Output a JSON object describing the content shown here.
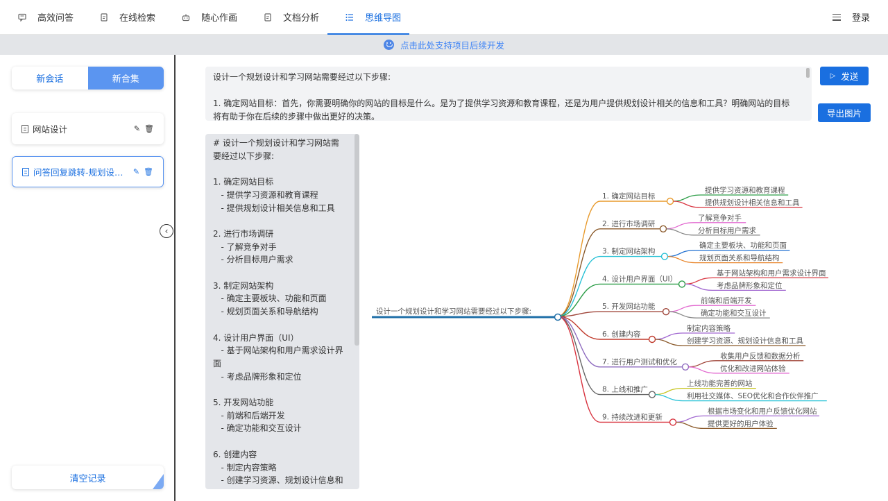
{
  "nav": {
    "items": [
      {
        "label": "高效问答",
        "icon": "chat-icon"
      },
      {
        "label": "在线检索",
        "icon": "document-icon"
      },
      {
        "label": "随心作画",
        "icon": "robot-icon"
      },
      {
        "label": "文档分析",
        "icon": "document-icon"
      },
      {
        "label": "思维导图",
        "icon": "list-icon",
        "active": true
      }
    ],
    "login": "登录"
  },
  "banner": {
    "text": "点击此处支持项目后续开发"
  },
  "sidebar": {
    "seg_new_chat": "新会话",
    "seg_new_collection": "新合集",
    "sessions": [
      {
        "title": "网站设计"
      },
      {
        "title": "问答回复跳转-规划设计..."
      }
    ],
    "clear": "清空记录"
  },
  "prompt": {
    "line1": "设计一个规划设计和学习网站需要经过以下步骤:",
    "line2": "1. 确定网站目标：首先，你需要明确你的网站的目标是什么。是为了提供学习资源和教育课程，还是为用户提供规划设计相关的信息和工具？明确网站的目标将有助于你在后续的步骤中做出更好的决策。"
  },
  "buttons": {
    "send": "发送",
    "export": "导出图片"
  },
  "markdown": [
    "# 设计一个规划设计和学习网站需要经过以下步骤:",
    "",
    "1. 确定网站目标",
    "   - 提供学习资源和教育课程",
    "   - 提供规划设计相关信息和工具",
    "",
    "2. 进行市场调研",
    "   - 了解竞争对手",
    "   - 分析目标用户需求",
    "",
    "3. 制定网站架构",
    "   - 确定主要板块、功能和页面",
    "   - 规划页面关系和导航结构",
    "",
    "4. 设计用户界面（UI）",
    "   - 基于网站架构和用户需求设计界面",
    "   - 考虑品牌形象和定位",
    "",
    "5. 开发网站功能",
    "   - 前端和后端开发",
    "   - 确定功能和交互设计",
    "",
    "6. 创建内容",
    "   - 制定内容策略",
    "   - 创建学习资源、规划设计信息和工具"
  ],
  "mindmap": {
    "root": "设计一个规划设计和学习网站需要经过以下步骤:",
    "root_color": "#1f6fa8",
    "branches": [
      {
        "label": "1. 确定网站目标",
        "color": "#e89a2c",
        "children": [
          {
            "label": "提供学习资源和教育课程",
            "color": "#2e9e49"
          },
          {
            "label": "提供规划设计相关信息和工具",
            "color": "#d8333f"
          }
        ]
      },
      {
        "label": "2. 进行市场调研",
        "color": "#8b5a2b",
        "children": [
          {
            "label": "了解竞争对手",
            "color": "#e26ad0"
          },
          {
            "label": "分析目标用户需求",
            "color": "#888888"
          }
        ]
      },
      {
        "label": "3. 制定网站架构",
        "color": "#27c1d6",
        "children": [
          {
            "label": "确定主要板块、功能和页面",
            "color": "#1f6fd0"
          },
          {
            "label": "规划页面关系和导航结构",
            "color": "#e8862c"
          }
        ]
      },
      {
        "label": "4. 设计用户界面（UI）",
        "color": "#2e9e49",
        "children": [
          {
            "label": "基于网站架构和用户需求设计界面",
            "color": "#d8333f"
          },
          {
            "label": "考虑品牌形象和定位",
            "color": "#a066d0"
          }
        ]
      },
      {
        "label": "5. 开发网站功能",
        "color": "#a0463a",
        "children": [
          {
            "label": "前端和后端开发",
            "color": "#e26ad0"
          },
          {
            "label": "确定功能和交互设计",
            "color": "#888888"
          }
        ]
      },
      {
        "label": "6. 创建内容",
        "color": "#c0392b",
        "children": [
          {
            "label": "制定内容策略",
            "color": "#a066d0"
          },
          {
            "label": "创建学习资源、规划设计信息和工具",
            "color": "#8b5a2b"
          }
        ]
      },
      {
        "label": "7. 进行用户测试和优化",
        "color": "#8e6bbf",
        "children": [
          {
            "label": "收集用户反馈和数据分析",
            "color": "#a0463a"
          },
          {
            "label": "优化和改进网站体验",
            "color": "#e26ad0"
          }
        ]
      },
      {
        "label": "8. 上线和推广",
        "color": "#666666",
        "children": [
          {
            "label": "上线功能完善的网站",
            "color": "#c7c520"
          },
          {
            "label": "利用社交媒体、SEO优化和合作伙伴推广",
            "color": "#27c1d6"
          }
        ]
      },
      {
        "label": "9. 持续改进和更新",
        "color": "#d8333f",
        "children": [
          {
            "label": "根据市场变化和用户反馈优化网站",
            "color": "#a066d0"
          },
          {
            "label": "提供更好的用户体验",
            "color": "#8b5a2b"
          }
        ]
      }
    ]
  }
}
